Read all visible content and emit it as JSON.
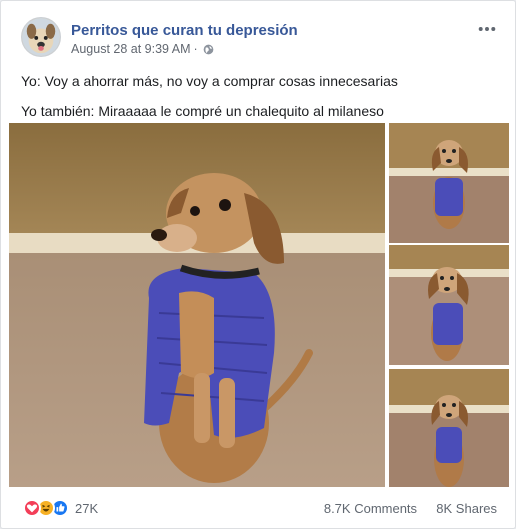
{
  "post": {
    "page_name": "Perritos que curan tu depresión",
    "date": "August 28 at 9:39 AM",
    "separator": "·",
    "privacy_icon": "globe-icon",
    "more_icon": "more-horizontal-icon",
    "text_lines": [
      "Yo: Voy a ahorrar más, no voy a comprar cosas innecesarias",
      "Yo también: Miraaaaa le compré un chalequito al milaneso"
    ]
  },
  "photos": {
    "count": 4,
    "main_alt": "Dachshund wearing a purple puffer vest sitting up",
    "thumbnails": [
      "dog-photo-2",
      "dog-photo-3",
      "dog-photo-4"
    ]
  },
  "footer": {
    "reaction_icons": [
      "love",
      "haha",
      "like"
    ],
    "reaction_count": "27K",
    "comments": "8.7K Comments",
    "shares": "8K Shares"
  },
  "colors": {
    "link_blue": "#385898",
    "meta_gray": "#616770",
    "love_red": "#f33e58",
    "haha_yellow": "#f7b125",
    "like_blue": "#1877f2",
    "vest_purple": "#4b4db8"
  }
}
